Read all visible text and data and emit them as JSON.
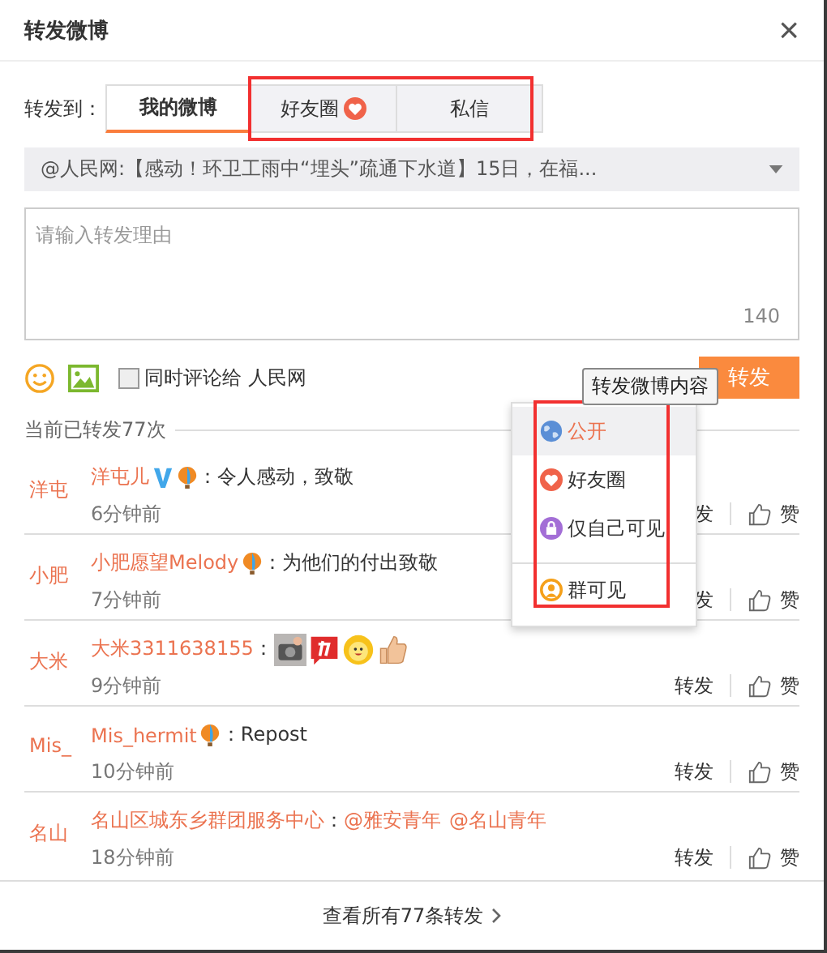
{
  "dialog": {
    "title": "转发微博",
    "close": "×"
  },
  "target": {
    "label": "转发到：",
    "tabs": [
      {
        "label": "我的微博",
        "selected": true
      },
      {
        "label": "好友圈",
        "selected": false
      },
      {
        "label": "私信",
        "selected": false
      }
    ]
  },
  "source": {
    "text": "@人民网:【感动！环卫工雨中“埋头”疏通下水道】15日，在福..."
  },
  "reason": {
    "placeholder": "请输入转发理由",
    "counter": "140"
  },
  "options": {
    "comment_label": "同时评论给 人民网",
    "checked": false,
    "submit": "转发",
    "tooltip": "转发微博内容"
  },
  "visibility_menu": [
    {
      "label": "公开",
      "selected": true
    },
    {
      "label": "好友圈",
      "selected": false
    },
    {
      "label": "仅自己可见",
      "selected": false
    },
    {
      "label": "群可见",
      "selected": false
    }
  ],
  "reposts": {
    "count_label": "当前已转发77次",
    "items": [
      {
        "avatar": "洋屯",
        "name": "洋屯儿",
        "badges": [
          {
            "kind": "verified"
          },
          {
            "kind": "balloon"
          }
        ],
        "content": [
          {
            "kind": "text",
            "text": "：令人感动，致敬"
          }
        ],
        "time": "6分钟前",
        "repost": "发",
        "like": "赞"
      },
      {
        "avatar": "小肥",
        "name": "小肥愿望Melody",
        "badges": [
          {
            "kind": "balloon"
          }
        ],
        "content": [
          {
            "kind": "text",
            "text": "：为他们的付出致敬"
          }
        ],
        "time": "7分钟前",
        "repost": "发",
        "like": "赞"
      },
      {
        "avatar": "大米",
        "name": "大米3311638155",
        "content": [
          {
            "kind": "text",
            "text": "："
          },
          {
            "kind": "emoji"
          },
          {
            "kind": "emoji"
          },
          {
            "kind": "emoji"
          },
          {
            "kind": "emoji"
          }
        ],
        "time": "9分钟前",
        "repost": "转发",
        "like": "赞"
      },
      {
        "avatar": "Mis_",
        "name": "Mis_hermit",
        "badges": [
          {
            "kind": "balloon"
          }
        ],
        "content": [
          {
            "kind": "text",
            "text": "：Repost"
          }
        ],
        "time": "10分钟前",
        "repost": "转发",
        "like": "赞"
      },
      {
        "avatar": "名山",
        "name": "名山区城东乡群团服务中心",
        "content": [
          {
            "kind": "text",
            "text": "："
          },
          {
            "kind": "mention",
            "text": "@雅安青年"
          },
          {
            "kind": "mention",
            "text": "@名山青年"
          }
        ],
        "time": "18分钟前",
        "repost": "转发",
        "like": "赞"
      }
    ],
    "more": "查看所有77条转发"
  }
}
